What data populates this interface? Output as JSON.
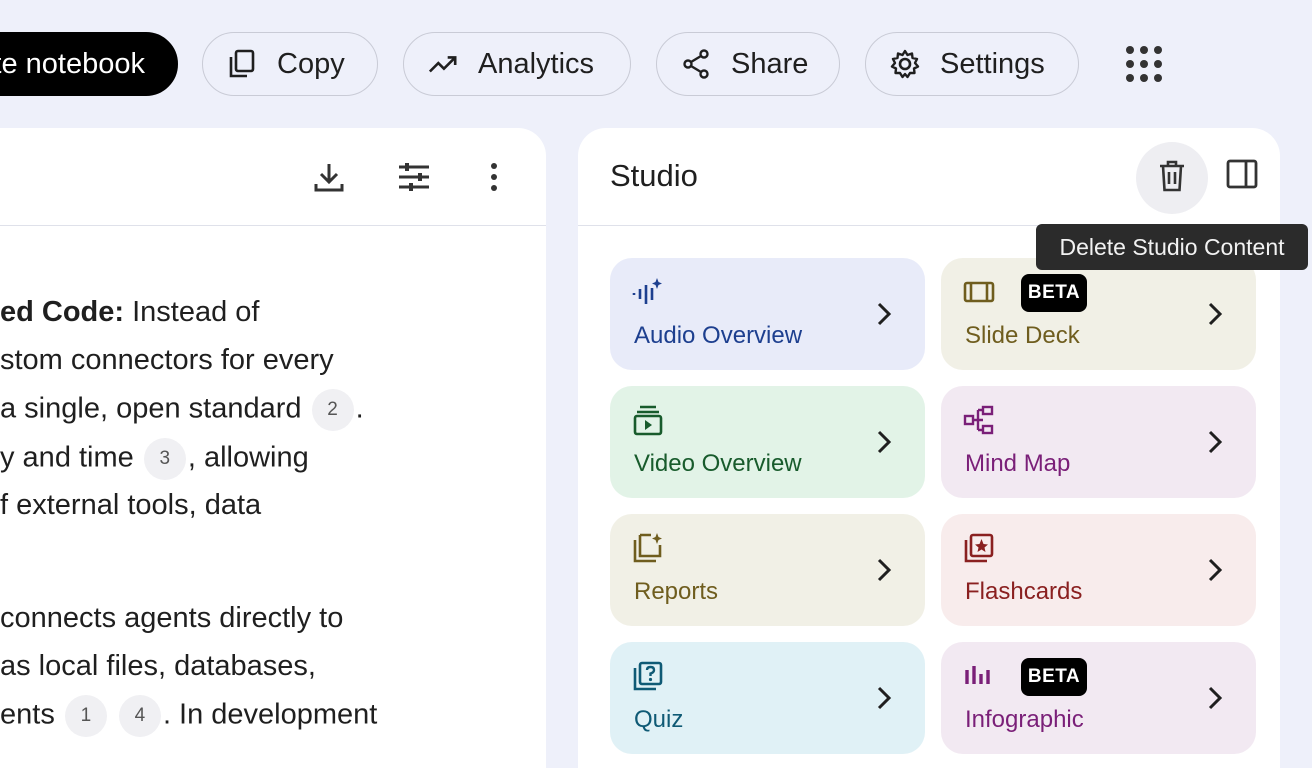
{
  "toolbar": {
    "create_label": "te notebook",
    "copy_label": "Copy",
    "analytics_label": "Analytics",
    "share_label": "Share",
    "settings_label": "Settings"
  },
  "chat": {
    "lines": [
      {
        "bold": "ed Code:",
        "text": " Instead of"
      },
      {
        "text": "stom connectors for every"
      },
      {
        "text": " a single, open standard ",
        "cite": "2",
        "after": "."
      },
      {
        "text": "y and time ",
        "cite": "3",
        "after": ", allowing"
      },
      {
        "text": "f external tools, data"
      },
      {
        "text": " connects agents directly to"
      },
      {
        "text": "as local files, databases,"
      },
      {
        "text": "ents ",
        "cite": "1",
        "cite2": "4",
        "after": ". In development"
      }
    ]
  },
  "studio": {
    "title": "Studio",
    "tooltip": "Delete Studio Content",
    "cards": [
      {
        "label": "Audio Overview",
        "icon": "audio-waveform-icon",
        "bg": "#e8ebf9",
        "fg": "#1d3f8f",
        "badge": ""
      },
      {
        "label": "Slide Deck",
        "icon": "slides-icon",
        "bg": "#f1f0e6",
        "fg": "#6f5d1e",
        "badge": "BETA"
      },
      {
        "label": "Video Overview",
        "icon": "video-icon",
        "bg": "#e2f3e7",
        "fg": "#185b2c",
        "badge": ""
      },
      {
        "label": "Mind Map",
        "icon": "mind-map-icon",
        "bg": "#f2e9f2",
        "fg": "#7a1f78",
        "badge": ""
      },
      {
        "label": "Reports",
        "icon": "reports-icon",
        "bg": "#f1f0e6",
        "fg": "#6f5d1e",
        "badge": ""
      },
      {
        "label": "Flashcards",
        "icon": "flashcards-icon",
        "bg": "#f8ecec",
        "fg": "#8a2020",
        "badge": ""
      },
      {
        "label": "Quiz",
        "icon": "quiz-icon",
        "bg": "#e0f1f6",
        "fg": "#0f5a75",
        "badge": ""
      },
      {
        "label": "Infographic",
        "icon": "infographic-icon",
        "bg": "#f2e9f2",
        "fg": "#7a1f78",
        "badge": "BETA"
      }
    ]
  }
}
